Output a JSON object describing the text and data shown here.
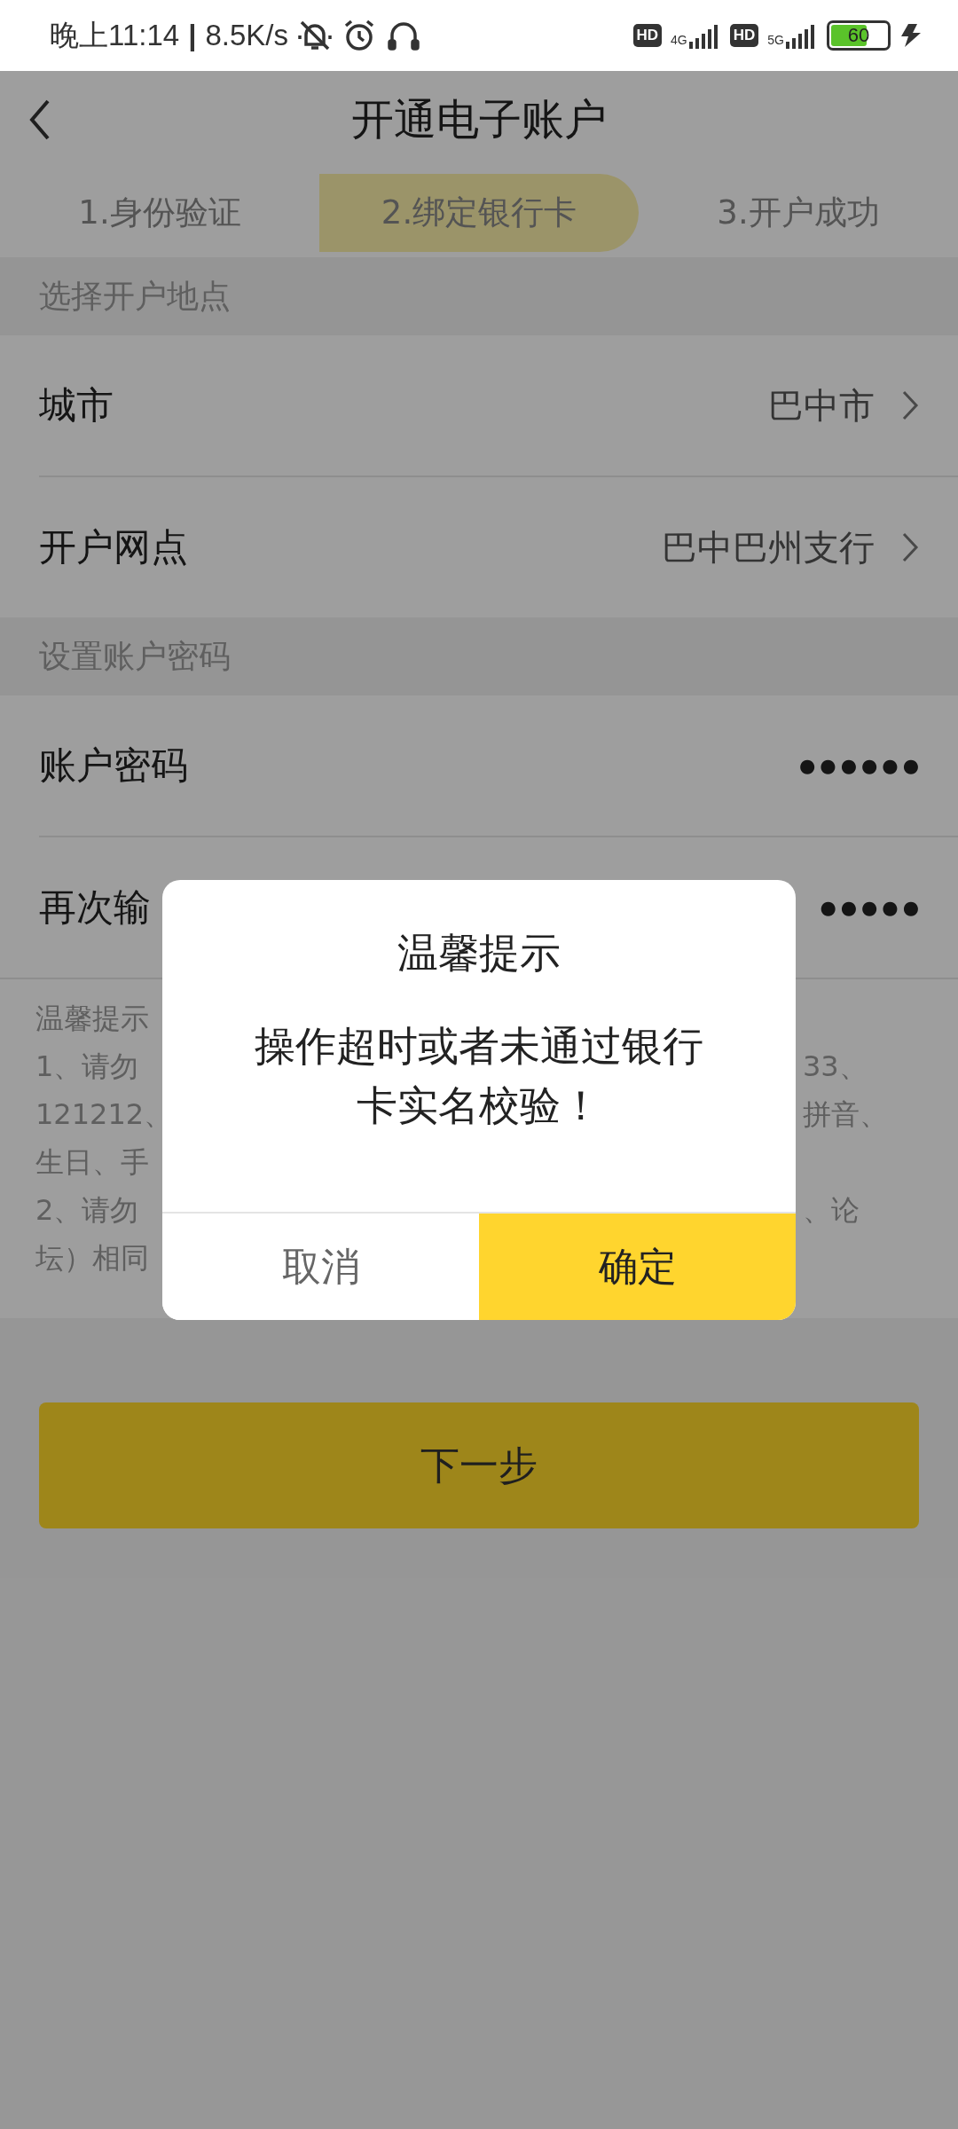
{
  "status_bar": {
    "time": "晚上11:14",
    "separator": "|",
    "speed": "8.5K/s",
    "sims": [
      {
        "badge": "HD",
        "network": "4G"
      },
      {
        "badge": "HD",
        "network": "5G"
      }
    ],
    "battery": {
      "text": "60",
      "level": 0.6
    }
  },
  "header": {
    "title": "开通电子账户"
  },
  "steps": [
    {
      "label": "1.身份验证",
      "selected": false
    },
    {
      "label": "2.绑定银行卡",
      "selected": true
    },
    {
      "label": "3.开户成功",
      "selected": false
    }
  ],
  "sections": [
    {
      "title": "选择开户地点",
      "rows": [
        {
          "kind": "select",
          "label": "城市",
          "value": "巴中市"
        },
        {
          "kind": "select",
          "label": "开户网点",
          "value": "巴中巴州支行"
        }
      ]
    },
    {
      "title": "设置账户密码",
      "rows": [
        {
          "kind": "password",
          "label": "账户密码",
          "value": "●●●●●●"
        },
        {
          "kind": "password",
          "label": "再次输",
          "value": "●●●●●"
        }
      ]
    }
  ],
  "hint_lines": [
    {
      "left": "温馨提示"
    },
    {
      "left": "1、请勿",
      "right": "33、"
    },
    {
      "left": "121212、",
      "right": "拼音、"
    },
    {
      "left": "生日、手"
    },
    {
      "left": "2、请勿",
      "right": "、论"
    },
    {
      "left": "坛）相同"
    }
  ],
  "next_button": "下一步",
  "dialog": {
    "title": "温馨提示",
    "message": "操作超时或者未通过银行卡实名校验！",
    "buttons": [
      {
        "kind": "secondary",
        "label": "取消"
      },
      {
        "kind": "primary",
        "label": "确定"
      }
    ]
  }
}
